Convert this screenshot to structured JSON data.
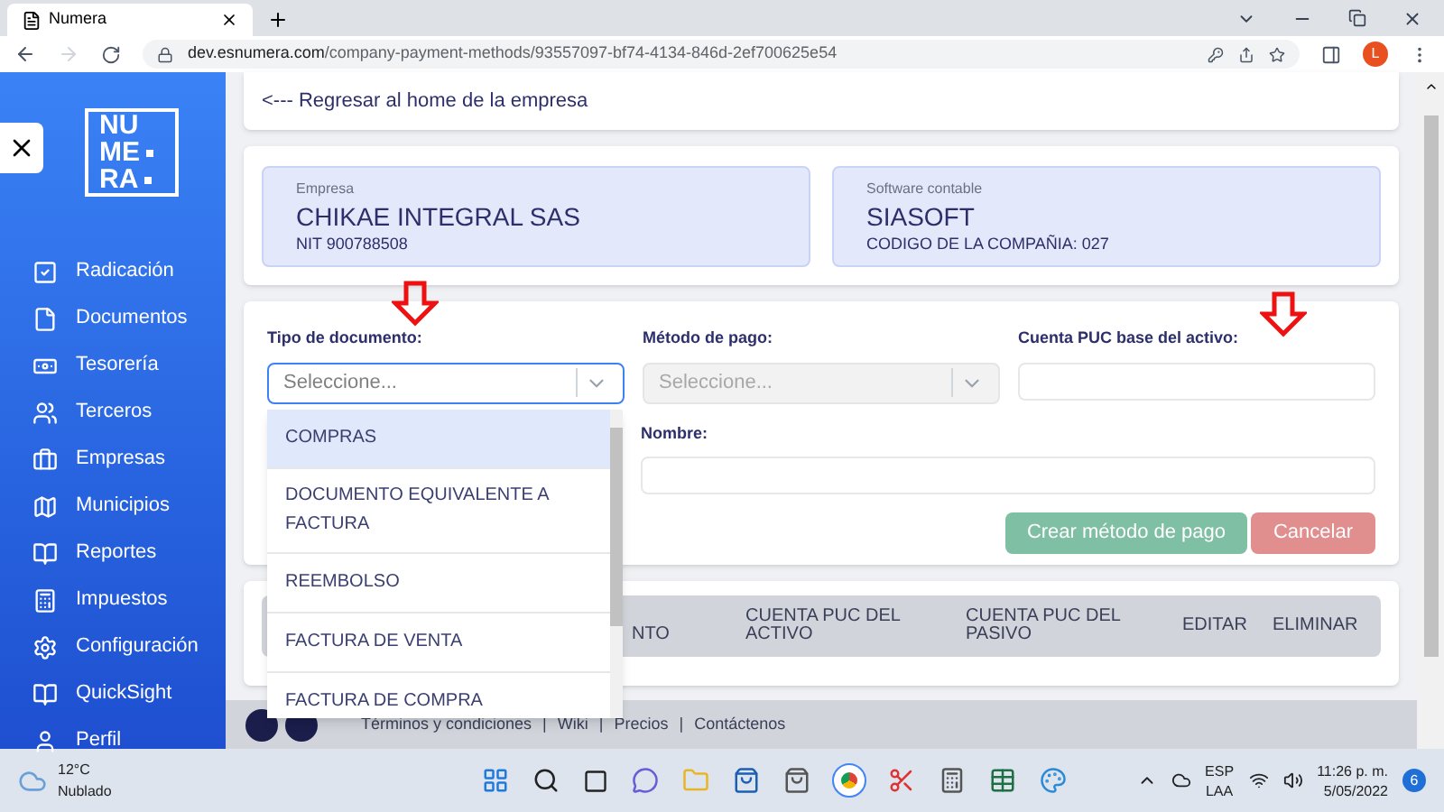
{
  "browser": {
    "tab": {
      "title": "Numera"
    },
    "url": {
      "host": "dev.esnumera.com",
      "path": "/company-payment-methods/93557097-bf74-4134-846d-2ef700625e54"
    },
    "profile": "L"
  },
  "logo": [
    "NU",
    "ME",
    "RA"
  ],
  "sidebar": {
    "items": [
      {
        "label": "Radicación",
        "kind": "check"
      },
      {
        "label": "Documentos",
        "kind": "file"
      },
      {
        "label": "Tesorería",
        "kind": "bag"
      },
      {
        "label": "Terceros",
        "kind": "users"
      },
      {
        "label": "Empresas",
        "kind": "briefcase"
      },
      {
        "label": "Municipios",
        "kind": "map"
      },
      {
        "label": "Reportes",
        "kind": "book"
      },
      {
        "label": "Impuestos",
        "kind": "calculator"
      },
      {
        "label": "Configuración",
        "kind": "gear"
      },
      {
        "label": "QuickSight",
        "kind": "book"
      },
      {
        "label": "Perfil",
        "kind": "user"
      }
    ]
  },
  "back_link": "<--- Regresar al home de la empresa",
  "company": {
    "label": "Empresa",
    "name": "CHIKAE INTEGRAL SAS",
    "nit": "NIT 900788508"
  },
  "software": {
    "label": "Software contable",
    "name": "SIASOFT",
    "code": "CODIGO DE LA COMPAÑIA: 027"
  },
  "form": {
    "tipo": {
      "label": "Tipo de documento:",
      "placeholder": "Seleccione...",
      "disabled": false
    },
    "metodo": {
      "label": "Método de pago:",
      "placeholder": "Seleccione...",
      "disabled": true
    },
    "cuenta": {
      "label": "Cuenta PUC base del activo:"
    },
    "nombre": {
      "label": "Nombre:"
    },
    "buttons": [
      {
        "label": "Crear método de pago",
        "kind": "primary",
        "disabled": true
      },
      {
        "label": "Cancelar",
        "kind": "danger",
        "disabled": true
      }
    ]
  },
  "dropdown": {
    "options": [
      {
        "label": "COMPRAS",
        "selected": true
      },
      {
        "label": "DOCUMENTO EQUIVALENTE A FACTURA",
        "selected": false
      },
      {
        "label": "REEMBOLSO",
        "selected": false
      },
      {
        "label": "FACTURA DE VENTA",
        "selected": false
      },
      {
        "label": "FACTURA DE COMPRA",
        "selected": false
      }
    ]
  },
  "table": {
    "columns": [
      "NTO",
      "CUENTA PUC DEL ACTIVO",
      "CUENTA PUC DEL PASIVO",
      "EDITAR",
      "ELIMINAR"
    ]
  },
  "footer": {
    "separator": "|",
    "links": [
      "Términos y condiciones",
      "Wiki",
      "Precios",
      "Contáctenos"
    ]
  },
  "taskbar": {
    "weather": {
      "temp": "12°C",
      "desc": "Nublado"
    },
    "lang": [
      "ESP",
      "LAA"
    ],
    "time": "11:26 p. m.",
    "date": "5/05/2022",
    "notifications": "6"
  }
}
